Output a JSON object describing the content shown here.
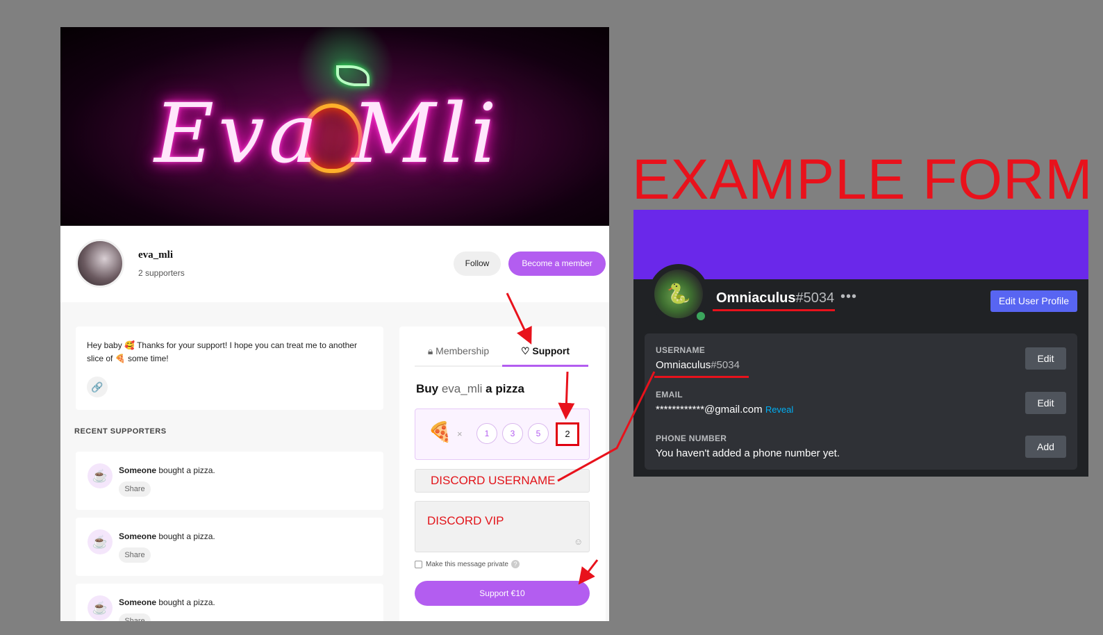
{
  "creator": {
    "name": "eva_mli",
    "supporters": "2 supporters",
    "follow_label": "Follow",
    "member_label": "Become a member"
  },
  "message": {
    "line1": "Hey baby 🥰 Thanks for your support! I hope you can treat me to another",
    "line2": "slice of 🍕 some time!"
  },
  "recent": {
    "title": "RECENT SUPPORTERS",
    "items": [
      {
        "who": "Someone",
        "action": " bought a pizza.",
        "share": "Share"
      },
      {
        "who": "Someone",
        "action": " bought a pizza.",
        "share": "Share"
      },
      {
        "who": "Someone",
        "action": " bought a pizza.",
        "share": "Share"
      }
    ]
  },
  "panel": {
    "tab_membership": "Membership",
    "tab_support": "Support",
    "buy_prefix": "Buy ",
    "buy_name": "eva_mli",
    "buy_suffix": " a pizza",
    "times": "×",
    "quick": [
      "1",
      "3",
      "5"
    ],
    "quantity": "2",
    "name_field": "DISCORD USERNAME",
    "message_field": "DISCORD VIP",
    "private_label": "Make this message private",
    "support_button": "Support €10"
  },
  "annotation": {
    "title": "EXAMPLE FORM"
  },
  "discord": {
    "name": "Omniaculus",
    "tag": "#5034",
    "dots": "•••",
    "edit_profile": "Edit User Profile",
    "username_label": "USERNAME",
    "username_value": "Omniaculus",
    "username_tag": "#5034",
    "email_label": "EMAIL",
    "email_value": "************@gmail.com",
    "reveal": "Reveal",
    "phone_label": "PHONE NUMBER",
    "phone_value": "You haven't added a phone number yet.",
    "edit1": "Edit",
    "edit2": "Edit",
    "add": "Add"
  },
  "colors": {
    "accent": "#b35df0",
    "annotation_red": "#e8121c",
    "discord_blurple": "#5865f2",
    "discord_banner": "#6a28ea"
  },
  "icons": [
    "link-icon",
    "heart-icon",
    "lock-icon",
    "pizza-icon",
    "smile-icon",
    "help-icon",
    "cup-icon",
    "more-icon"
  ]
}
